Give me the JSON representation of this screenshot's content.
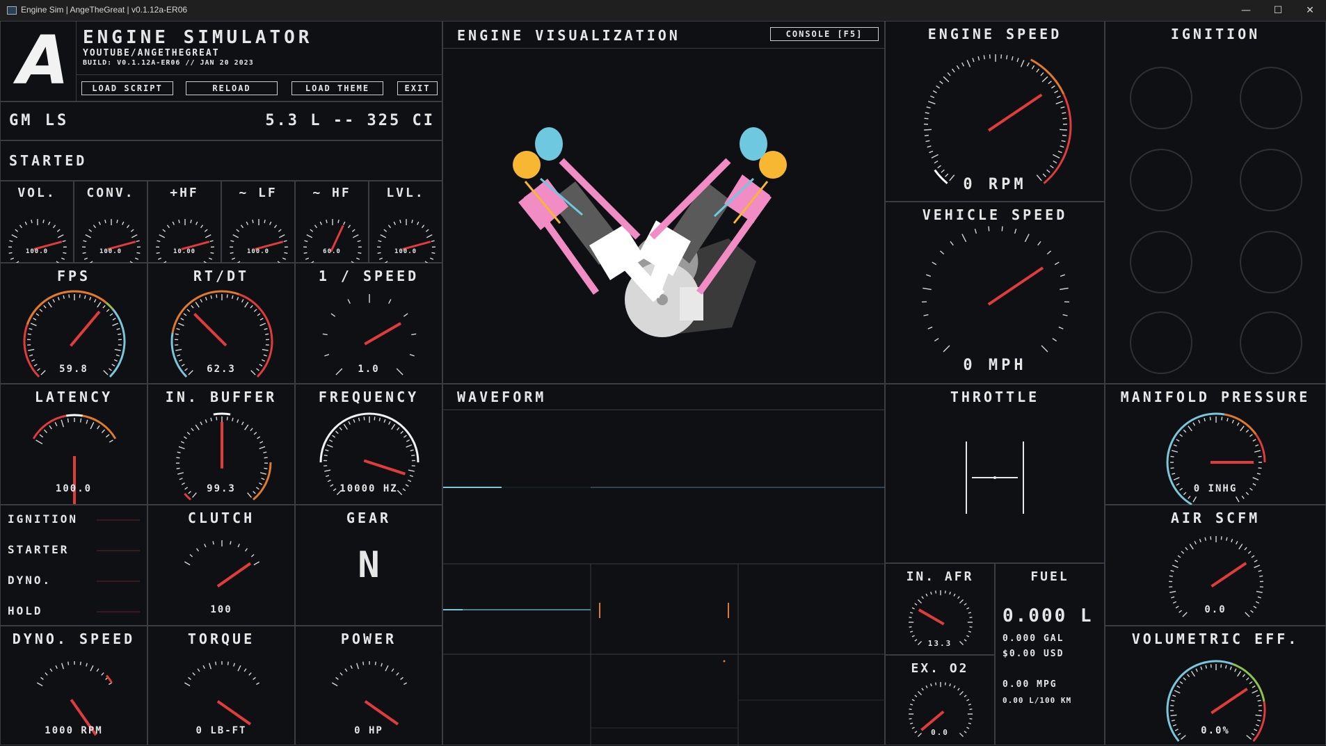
{
  "window": {
    "title": "Engine Sim | AngeTheGreat | v0.1.12a-ER06",
    "minimize_glyph": "—",
    "maximize_glyph": "☐",
    "close_glyph": "✕"
  },
  "header": {
    "logo_letter": "A",
    "app_name": "ENGINE SIMULATOR",
    "channel": "YOUTUBE/ANGETHEGREAT",
    "build": "BUILD: V0.1.12A-ER06 // JAN 20 2023",
    "buttons": [
      "LOAD SCRIPT",
      "RELOAD",
      "LOAD THEME",
      "EXIT"
    ]
  },
  "engine": {
    "name": "GM LS",
    "displacement": "5.3 L -- 325 CI",
    "status": "STARTED"
  },
  "visualization": {
    "title": "ENGINE VISUALIZATION",
    "console_button": "CONSOLE [F5]"
  },
  "waveform": {
    "title": "WAVEFORM"
  },
  "small_gauges": [
    {
      "label": "VOL.",
      "value": "100.0",
      "fraction": 0.8
    },
    {
      "label": "CONV.",
      "value": "100.0",
      "fraction": 0.8
    },
    {
      "label": "+HF",
      "value": "10.00",
      "fraction": 0.8
    },
    {
      "label": "~ LF",
      "value": "100.0",
      "fraction": 0.8
    },
    {
      "label": "~ HF",
      "value": "60.0",
      "fraction": 0.6
    },
    {
      "label": "LVL.",
      "value": "100.0",
      "fraction": 0.8
    }
  ],
  "gauges": {
    "fps": {
      "label": "FPS",
      "value": "59.8"
    },
    "rtdt": {
      "label": "RT/DT",
      "value": "62.3"
    },
    "inv_speed": {
      "label": "1 / SPEED",
      "value": "1.0"
    },
    "latency": {
      "label": "LATENCY",
      "value": "100.0"
    },
    "in_buffer": {
      "label": "IN. BUFFER",
      "value": "99.3"
    },
    "frequency": {
      "label": "FREQUENCY",
      "value": "10000 HZ"
    },
    "clutch": {
      "label": "CLUTCH",
      "value": "100"
    },
    "gear": {
      "label": "GEAR",
      "value": "N"
    },
    "dyno_speed": {
      "label": "DYNO. SPEED",
      "value": "1000 RPM"
    },
    "torque": {
      "label": "TORQUE",
      "value": "0 LB-FT"
    },
    "power": {
      "label": "POWER",
      "value": "0 HP"
    },
    "engine_speed": {
      "label": "ENGINE SPEED",
      "value": "0 RPM"
    },
    "vehicle_speed": {
      "label": "VEHICLE SPEED",
      "value": "0 MPH"
    },
    "ignition": {
      "label": "IGNITION"
    },
    "throttle": {
      "label": "THROTTLE"
    },
    "manifold": {
      "label": "MANIFOLD PRESSURE",
      "value": "0 INHG"
    },
    "air_scfm": {
      "label": "AIR SCFM",
      "value": "0.0"
    },
    "vol_eff": {
      "label": "VOLUMETRIC EFF.",
      "value": "0.0%"
    },
    "in_afr": {
      "label": "IN. AFR",
      "value": "13.3"
    },
    "ex_o2": {
      "label": "EX. O2",
      "value": "0.0"
    }
  },
  "status_list": [
    "IGNITION",
    "STARTER",
    "DYNO.",
    "HOLD"
  ],
  "fuel": {
    "label": "FUEL",
    "liters": "0.000 L",
    "gallons": "0.000 GAL",
    "usd": "$0.00 USD",
    "mpg": "0.00 MPG",
    "l100": "0.00 L/100 KM"
  },
  "colors": {
    "red": "#e03c3c",
    "orange": "#e07a2c",
    "blue": "#7cc6dc",
    "green": "#8fc24a",
    "pink": "#f28cc4",
    "yellow": "#f7b733",
    "cyan": "#6dc8e0"
  }
}
